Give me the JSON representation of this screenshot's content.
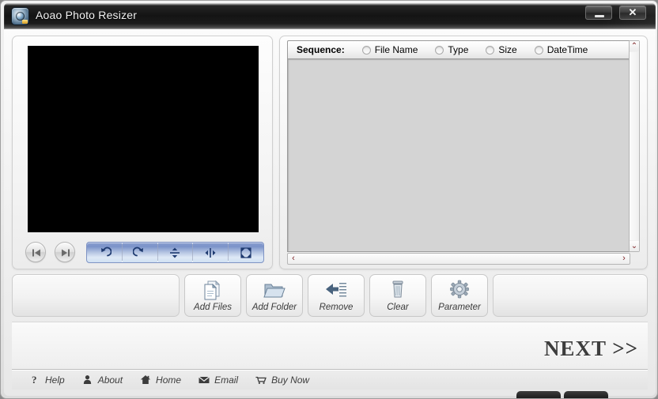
{
  "window": {
    "title": "Aoao Photo Resizer",
    "app_icon": "camera-icon",
    "minimize_label": "–",
    "close_label": "✕"
  },
  "preview": {
    "prev_label": "previous-image",
    "next_label": "next-image",
    "edit_tools": [
      {
        "name": "rotate-left-icon",
        "tooltip": "Rotate Left"
      },
      {
        "name": "rotate-right-icon",
        "tooltip": "Rotate Right"
      },
      {
        "name": "flip-vertical-icon",
        "tooltip": "Flip Vertical"
      },
      {
        "name": "flip-horizontal-icon",
        "tooltip": "Flip Horizontal"
      },
      {
        "name": "fullscreen-icon",
        "tooltip": "Full Screen"
      }
    ]
  },
  "list": {
    "sequence_label": "Sequence:",
    "sort_options": [
      {
        "label": "File Name",
        "selected": false
      },
      {
        "label": "Type",
        "selected": false
      },
      {
        "label": "Size",
        "selected": false
      },
      {
        "label": "DateTime",
        "selected": false
      }
    ],
    "rows": [],
    "scroll": {
      "up": "⌃",
      "down": "⌄",
      "left": "‹",
      "right": "›"
    }
  },
  "toolbar": {
    "buttons": [
      {
        "label": "Add Files",
        "icon": "documents-icon"
      },
      {
        "label": "Add Folder",
        "icon": "folder-icon"
      },
      {
        "label": "Remove",
        "icon": "arrow-left-list-icon"
      },
      {
        "label": "Clear",
        "icon": "trash-icon"
      },
      {
        "label": "Parameter",
        "icon": "gear-icon"
      }
    ]
  },
  "footer": {
    "next_label": "NEXT >>",
    "links": [
      {
        "label": "Help",
        "icon": "question-mark-icon"
      },
      {
        "label": "About",
        "icon": "person-icon"
      },
      {
        "label": "Home",
        "icon": "house-icon"
      },
      {
        "label": "Email",
        "icon": "envelope-icon"
      },
      {
        "label": "Buy Now",
        "icon": "shopping-cart-icon"
      }
    ]
  },
  "colors": {
    "titlebar": "#141414",
    "edit_toolbar_accent": "#7b93c9",
    "scrollbar_arrow": "#7d1f22",
    "preview_background": "#000000",
    "list_background": "#d4d4d4"
  }
}
